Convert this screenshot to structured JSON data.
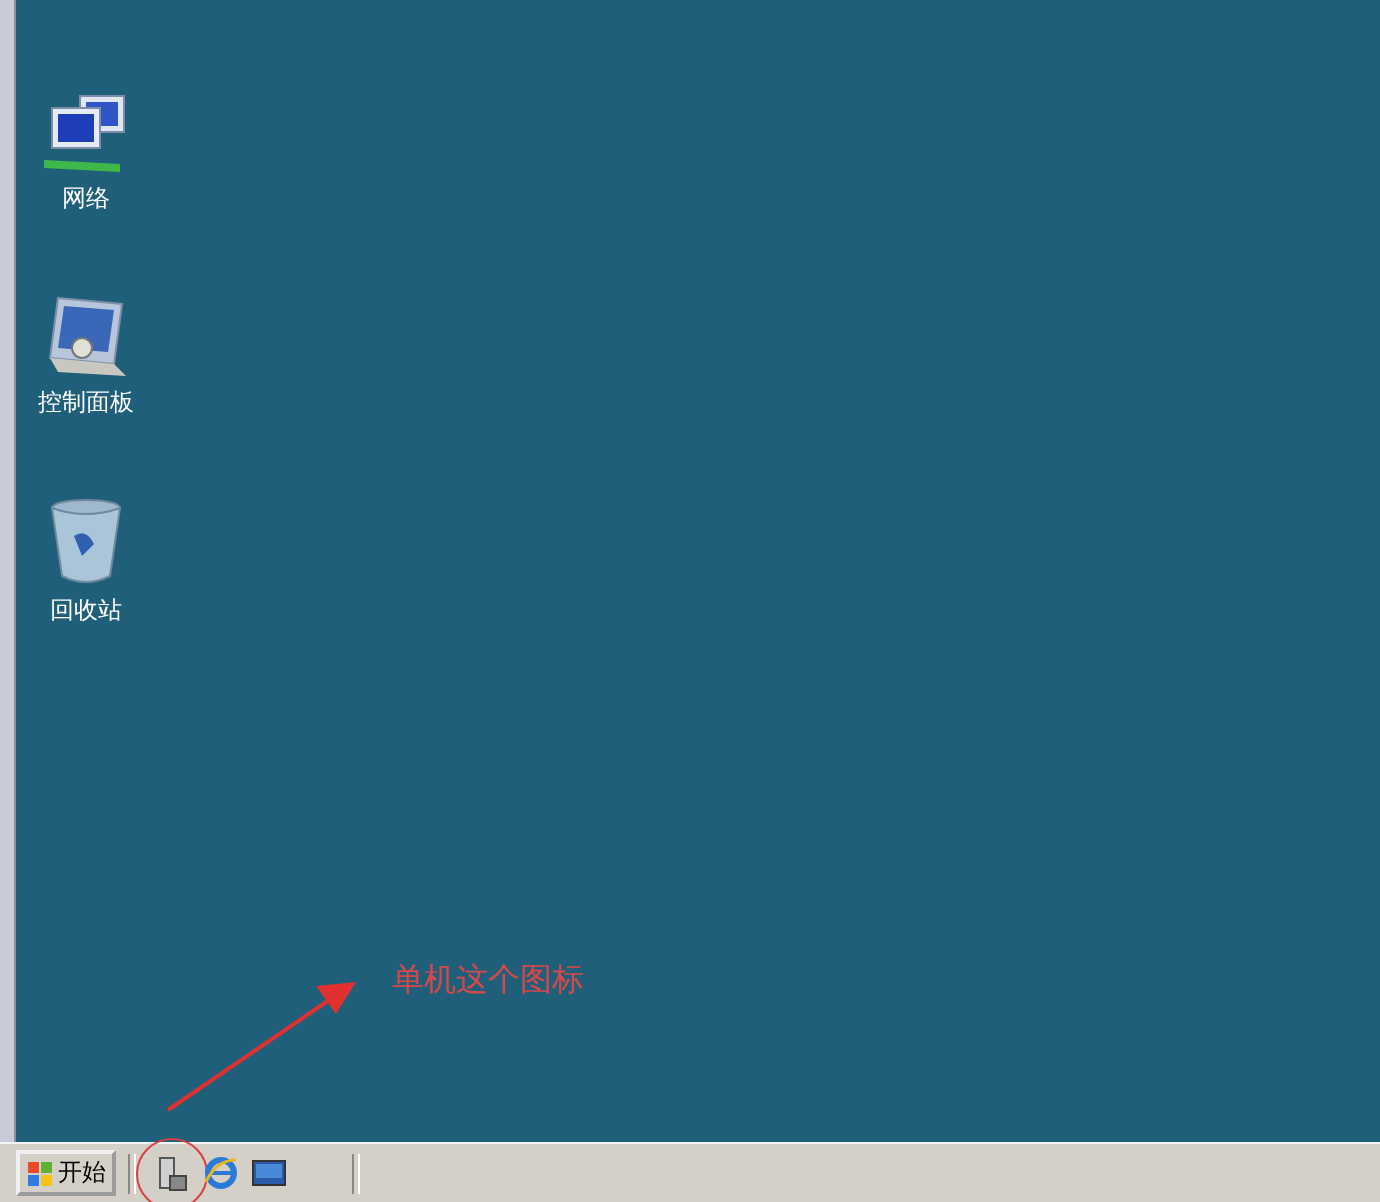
{
  "desktop_icons": [
    {
      "kind": "network",
      "label": "网络"
    },
    {
      "kind": "control-panel",
      "label": "控制面板"
    },
    {
      "kind": "recycle-bin",
      "label": "回收站"
    }
  ],
  "taskbar": {
    "start_button": "开始",
    "quick_launch": [
      {
        "kind": "server-manager",
        "highlighted": true
      },
      {
        "kind": "browser",
        "highlighted": false
      },
      {
        "kind": "desktop",
        "highlighted": false
      }
    ]
  },
  "annotation": {
    "text": "单机这个图标"
  }
}
